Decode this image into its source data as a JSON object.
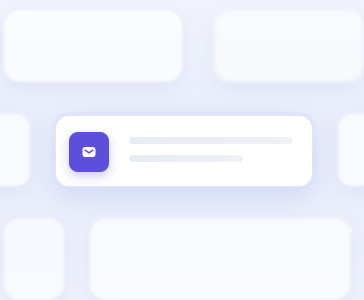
{
  "background": {
    "gradient_top": "#f0f3fb",
    "gradient_bottom": "#eef1fb"
  },
  "notification_card": {
    "icon": "mail-icon",
    "icon_background": "#5d4fdc",
    "placeholder_line_color": "#e6ecf3"
  },
  "decoration": {
    "sparkle_icon": "sparkle-icon"
  }
}
